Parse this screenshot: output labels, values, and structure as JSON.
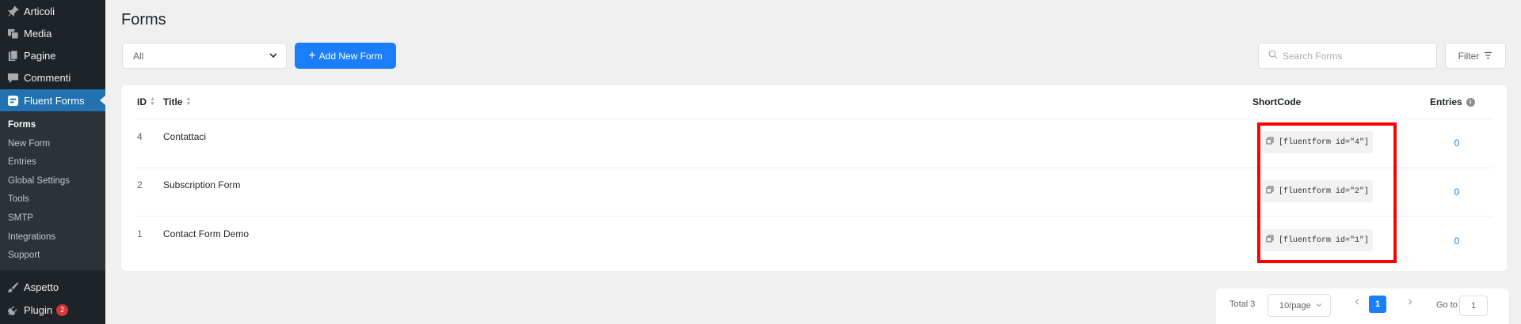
{
  "sidebar": {
    "items": [
      {
        "label": "Articoli",
        "icon": "pin-icon"
      },
      {
        "label": "Media",
        "icon": "media-icon"
      },
      {
        "label": "Pagine",
        "icon": "page-icon"
      },
      {
        "label": "Commenti",
        "icon": "comment-icon"
      },
      {
        "label": "Fluent Forms",
        "icon": "fluent-forms-icon"
      },
      {
        "label": "Aspetto",
        "icon": "appearance-icon"
      },
      {
        "label": "Plugin",
        "icon": "plugin-icon",
        "badge": "2"
      }
    ],
    "submenu": [
      "Forms",
      "New Form",
      "Entries",
      "Global Settings",
      "Tools",
      "SMTP",
      "Integrations",
      "Support"
    ]
  },
  "header": {
    "title": "Forms",
    "filter_select": "All",
    "add_button": "Add New Form",
    "search_placeholder": "Search Forms",
    "filter_button": "Filter"
  },
  "table": {
    "columns": {
      "id": "ID",
      "title": "Title",
      "shortcode": "ShortCode",
      "entries": "Entries"
    },
    "rows": [
      {
        "id": "4",
        "title": "Contattaci",
        "shortcode": "[fluentform id=\"4\"]",
        "entries": "0"
      },
      {
        "id": "2",
        "title": "Subscription Form",
        "shortcode": "[fluentform id=\"2\"]",
        "entries": "0"
      },
      {
        "id": "1",
        "title": "Contact Form Demo",
        "shortcode": "[fluentform id=\"1\"]",
        "entries": "0"
      }
    ]
  },
  "pagination": {
    "total": "Total 3",
    "page_size": "10/page",
    "current_page": "1",
    "goto_label": "Go to",
    "goto_value": "1"
  },
  "colors": {
    "primary": "#1a7efb",
    "sidebar_bg": "#1d2327",
    "sidebar_active": "#2271b1",
    "highlight": "#ff0000"
  }
}
